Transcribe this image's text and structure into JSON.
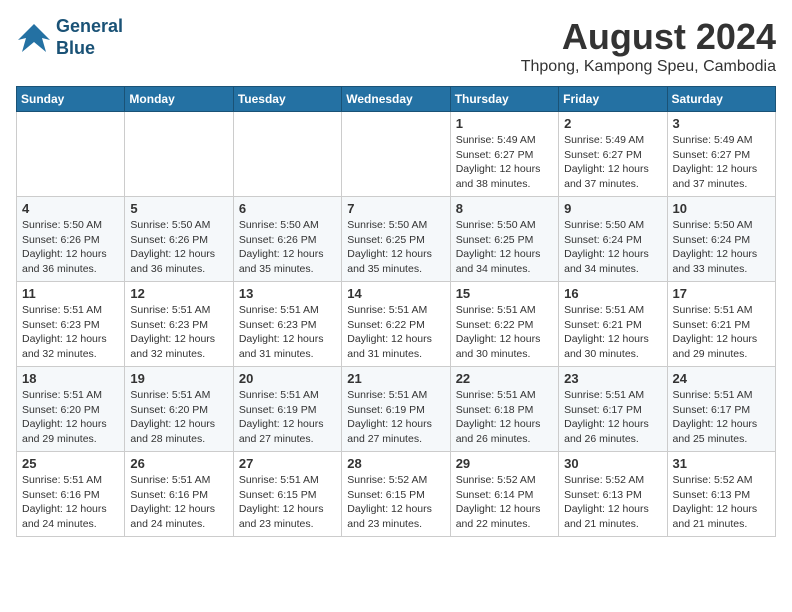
{
  "header": {
    "logo_line1": "General",
    "logo_line2": "Blue",
    "month_title": "August 2024",
    "location": "Thpong, Kampong Speu, Cambodia"
  },
  "weekdays": [
    "Sunday",
    "Monday",
    "Tuesday",
    "Wednesday",
    "Thursday",
    "Friday",
    "Saturday"
  ],
  "weeks": [
    [
      {
        "day": "",
        "detail": ""
      },
      {
        "day": "",
        "detail": ""
      },
      {
        "day": "",
        "detail": ""
      },
      {
        "day": "",
        "detail": ""
      },
      {
        "day": "1",
        "detail": "Sunrise: 5:49 AM\nSunset: 6:27 PM\nDaylight: 12 hours\nand 38 minutes."
      },
      {
        "day": "2",
        "detail": "Sunrise: 5:49 AM\nSunset: 6:27 PM\nDaylight: 12 hours\nand 37 minutes."
      },
      {
        "day": "3",
        "detail": "Sunrise: 5:49 AM\nSunset: 6:27 PM\nDaylight: 12 hours\nand 37 minutes."
      }
    ],
    [
      {
        "day": "4",
        "detail": "Sunrise: 5:50 AM\nSunset: 6:26 PM\nDaylight: 12 hours\nand 36 minutes."
      },
      {
        "day": "5",
        "detail": "Sunrise: 5:50 AM\nSunset: 6:26 PM\nDaylight: 12 hours\nand 36 minutes."
      },
      {
        "day": "6",
        "detail": "Sunrise: 5:50 AM\nSunset: 6:26 PM\nDaylight: 12 hours\nand 35 minutes."
      },
      {
        "day": "7",
        "detail": "Sunrise: 5:50 AM\nSunset: 6:25 PM\nDaylight: 12 hours\nand 35 minutes."
      },
      {
        "day": "8",
        "detail": "Sunrise: 5:50 AM\nSunset: 6:25 PM\nDaylight: 12 hours\nand 34 minutes."
      },
      {
        "day": "9",
        "detail": "Sunrise: 5:50 AM\nSunset: 6:24 PM\nDaylight: 12 hours\nand 34 minutes."
      },
      {
        "day": "10",
        "detail": "Sunrise: 5:50 AM\nSunset: 6:24 PM\nDaylight: 12 hours\nand 33 minutes."
      }
    ],
    [
      {
        "day": "11",
        "detail": "Sunrise: 5:51 AM\nSunset: 6:23 PM\nDaylight: 12 hours\nand 32 minutes."
      },
      {
        "day": "12",
        "detail": "Sunrise: 5:51 AM\nSunset: 6:23 PM\nDaylight: 12 hours\nand 32 minutes."
      },
      {
        "day": "13",
        "detail": "Sunrise: 5:51 AM\nSunset: 6:23 PM\nDaylight: 12 hours\nand 31 minutes."
      },
      {
        "day": "14",
        "detail": "Sunrise: 5:51 AM\nSunset: 6:22 PM\nDaylight: 12 hours\nand 31 minutes."
      },
      {
        "day": "15",
        "detail": "Sunrise: 5:51 AM\nSunset: 6:22 PM\nDaylight: 12 hours\nand 30 minutes."
      },
      {
        "day": "16",
        "detail": "Sunrise: 5:51 AM\nSunset: 6:21 PM\nDaylight: 12 hours\nand 30 minutes."
      },
      {
        "day": "17",
        "detail": "Sunrise: 5:51 AM\nSunset: 6:21 PM\nDaylight: 12 hours\nand 29 minutes."
      }
    ],
    [
      {
        "day": "18",
        "detail": "Sunrise: 5:51 AM\nSunset: 6:20 PM\nDaylight: 12 hours\nand 29 minutes."
      },
      {
        "day": "19",
        "detail": "Sunrise: 5:51 AM\nSunset: 6:20 PM\nDaylight: 12 hours\nand 28 minutes."
      },
      {
        "day": "20",
        "detail": "Sunrise: 5:51 AM\nSunset: 6:19 PM\nDaylight: 12 hours\nand 27 minutes."
      },
      {
        "day": "21",
        "detail": "Sunrise: 5:51 AM\nSunset: 6:19 PM\nDaylight: 12 hours\nand 27 minutes."
      },
      {
        "day": "22",
        "detail": "Sunrise: 5:51 AM\nSunset: 6:18 PM\nDaylight: 12 hours\nand 26 minutes."
      },
      {
        "day": "23",
        "detail": "Sunrise: 5:51 AM\nSunset: 6:17 PM\nDaylight: 12 hours\nand 26 minutes."
      },
      {
        "day": "24",
        "detail": "Sunrise: 5:51 AM\nSunset: 6:17 PM\nDaylight: 12 hours\nand 25 minutes."
      }
    ],
    [
      {
        "day": "25",
        "detail": "Sunrise: 5:51 AM\nSunset: 6:16 PM\nDaylight: 12 hours\nand 24 minutes."
      },
      {
        "day": "26",
        "detail": "Sunrise: 5:51 AM\nSunset: 6:16 PM\nDaylight: 12 hours\nand 24 minutes."
      },
      {
        "day": "27",
        "detail": "Sunrise: 5:51 AM\nSunset: 6:15 PM\nDaylight: 12 hours\nand 23 minutes."
      },
      {
        "day": "28",
        "detail": "Sunrise: 5:52 AM\nSunset: 6:15 PM\nDaylight: 12 hours\nand 23 minutes."
      },
      {
        "day": "29",
        "detail": "Sunrise: 5:52 AM\nSunset: 6:14 PM\nDaylight: 12 hours\nand 22 minutes."
      },
      {
        "day": "30",
        "detail": "Sunrise: 5:52 AM\nSunset: 6:13 PM\nDaylight: 12 hours\nand 21 minutes."
      },
      {
        "day": "31",
        "detail": "Sunrise: 5:52 AM\nSunset: 6:13 PM\nDaylight: 12 hours\nand 21 minutes."
      }
    ]
  ]
}
